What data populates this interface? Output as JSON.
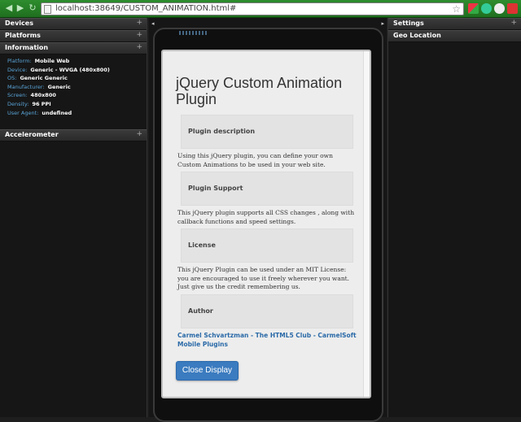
{
  "browser": {
    "url": "localhost:38649/CUSTOM_ANIMATION.html#"
  },
  "left_panel": {
    "sections": [
      {
        "title": "Devices",
        "expand": "+"
      },
      {
        "title": "Platforms",
        "expand": "+"
      },
      {
        "title": "Information",
        "expand": "+"
      }
    ],
    "info": [
      {
        "key": "Platform:",
        "value": "Mobile Web"
      },
      {
        "key": "Device:",
        "value": "Generic - WVGA (480x800)"
      },
      {
        "key": "OS:",
        "value": "Generic Generic"
      },
      {
        "key": "Manufacturer:",
        "value": "Generic"
      },
      {
        "key": "Screen:",
        "value": "480x800"
      },
      {
        "key": "Density:",
        "value": "96 PPI"
      },
      {
        "key": "User Agent:",
        "value": "undefined"
      }
    ],
    "accelerometer": {
      "title": "Accelerometer",
      "expand": "+"
    }
  },
  "right_panel": {
    "settings": "Settings",
    "settings_expand": "+",
    "geo": "Geo Location"
  },
  "device_controls": {
    "left_arrow": "◂",
    "right_arrow": "▸"
  },
  "page": {
    "title": "jQuery Custom Animation Plugin",
    "sections": [
      {
        "label": "Plugin description",
        "text": "Using this jQuery plugin, you can define your own Custom Animations to be used in your web site."
      },
      {
        "label": "Plugin Support",
        "text": "This jQuery plugin supports all CSS changes , along with callback functions and speed settings."
      },
      {
        "label": "License",
        "text": "This jQuery Plugin can be used under an MIT License: you are encouraged to use it freely wherever you want. Just give us the credit remembering us."
      },
      {
        "label": "Author",
        "text": "Carmel Schvartzman - The HTML5 Club - CarmelSoft Mobile Plugins"
      }
    ],
    "close_button": "Close Display"
  },
  "colors": {
    "chrome": "#2e8d2e",
    "info_key": "#5aa5d8",
    "link": "#2a6aa8",
    "button": "#3b7bbf"
  }
}
